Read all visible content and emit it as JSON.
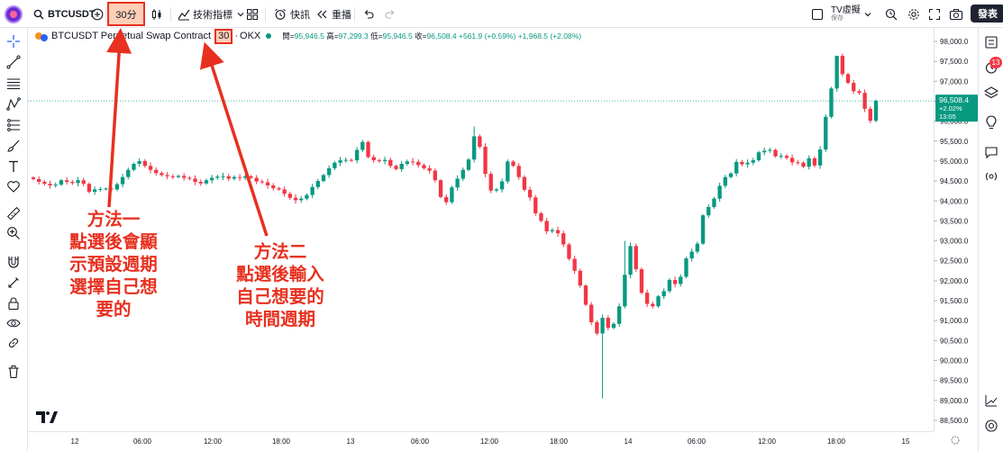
{
  "toolbar": {
    "symbol": "BTCUSDT",
    "interval": "30分",
    "indicators_label": "技術指標",
    "alert_label": "快訊",
    "replay_label": "重播",
    "layout_name": "TV虛擬",
    "layout_sub": "保存",
    "publish_label": "發表"
  },
  "legend": {
    "symbol_title": "BTCUSDT Perpetual Swap Contract",
    "timeframe": "30",
    "separator": "·",
    "exchange": "OKX",
    "open_label": "開=",
    "open_value": "95,946.5",
    "high_label": "高=",
    "high_value": "97,299.3",
    "low_label": "低=",
    "low_value": "95,946.5",
    "close_label": "收=",
    "close_value": "96,508.4",
    "change": "+561.9 (+0.59%)",
    "change2": "+1,968.5 (+2.08%)"
  },
  "price_tag": {
    "price": "96,508.4",
    "pct": "+2.02%",
    "countdown": "13:05"
  },
  "notifications_count": "13",
  "annotations": {
    "method1_lines": [
      "方法一",
      "點選後會顯",
      "示預設週期",
      "選擇自己想",
      "要的"
    ],
    "method2_lines": [
      "方法二",
      "點選後輸入",
      "自己想要的",
      "時間週期"
    ]
  },
  "colors": {
    "up": "#089981",
    "down": "#f23645",
    "annotation": "#e8301f",
    "highlight_fill": "#ffcfb8"
  },
  "chart_data": {
    "type": "candlestick",
    "symbol": "BTCUSDT",
    "interval_minutes": 30,
    "y_range": [
      88500,
      98000
    ],
    "y_ticks": [
      "98,000.0",
      "97,500.0",
      "97,000.0",
      "96,500.0",
      "96,000.0",
      "95,500.0",
      "95,000.0",
      "94,500.0",
      "94,000.0",
      "93,500.0",
      "93,000.0",
      "92,500.0",
      "92,000.0",
      "91,500.0",
      "91,000.0",
      "90,500.0",
      "90,000.0",
      "89,500.0",
      "89,000.0",
      "88,500.0"
    ],
    "x_ticks": [
      "12",
      "06:00",
      "12:00",
      "18:00",
      "13",
      "06:00",
      "12:00",
      "18:00",
      "14",
      "06:00",
      "12:00",
      "18:00",
      "15"
    ],
    "last_close": 96508.4,
    "closes": [
      94550,
      94480,
      94430,
      94390,
      94410,
      94520,
      94480,
      94450,
      94520,
      94430,
      94230,
      94290,
      94300,
      94310,
      94290,
      94420,
      94600,
      94780,
      94930,
      95000,
      94880,
      94780,
      94700,
      94650,
      94620,
      94600,
      94630,
      94580,
      94560,
      94480,
      94440,
      94520,
      94580,
      94610,
      94620,
      94560,
      94600,
      94580,
      94620,
      94580,
      94490,
      94470,
      94390,
      94320,
      94290,
      94180,
      94080,
      94020,
      94060,
      94150,
      94350,
      94500,
      94650,
      94820,
      94960,
      95020,
      95030,
      95020,
      95280,
      95480,
      95100,
      95020,
      95000,
      95030,
      94880,
      94800,
      94930,
      94990,
      94980,
      94900,
      94820,
      94760,
      94520,
      94100,
      93970,
      94340,
      94560,
      94780,
      95040,
      95620,
      95360,
      94680,
      94260,
      94290,
      94490,
      94990,
      94880,
      94600,
      94280,
      94090,
      93690,
      93500,
      93240,
      93270,
      93190,
      92910,
      92550,
      92250,
      91880,
      91400,
      90960,
      90680,
      91070,
      90820,
      90920,
      91360,
      92150,
      92870,
      92290,
      91700,
      91420,
      91360,
      91610,
      91740,
      92020,
      91920,
      92100,
      92560,
      92730,
      92930,
      93640,
      93850,
      94060,
      94380,
      94600,
      94690,
      94980,
      94920,
      94960,
      95020,
      95220,
      95260,
      95280,
      95120,
      95130,
      95080,
      94970,
      94960,
      94860,
      95070,
      94890,
      95290,
      96110,
      96820,
      97640,
      97180,
      96960,
      96750,
      96710,
      96310,
      96010,
      96510
    ]
  }
}
